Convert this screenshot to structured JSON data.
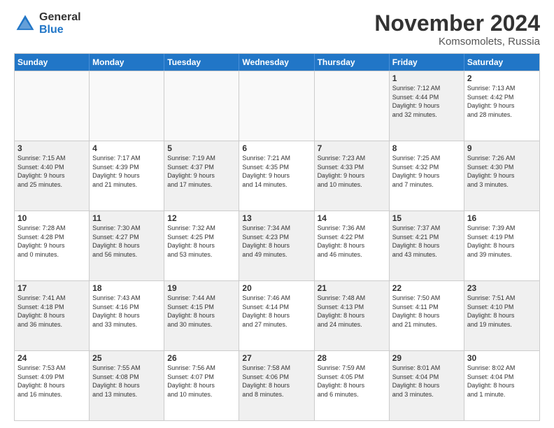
{
  "logo": {
    "general": "General",
    "blue": "Blue"
  },
  "title": "November 2024",
  "subtitle": "Komsomolets, Russia",
  "days": [
    "Sunday",
    "Monday",
    "Tuesday",
    "Wednesday",
    "Thursday",
    "Friday",
    "Saturday"
  ],
  "weeks": [
    [
      {
        "day": "",
        "info": "",
        "shaded": false,
        "empty": true
      },
      {
        "day": "",
        "info": "",
        "shaded": false,
        "empty": true
      },
      {
        "day": "",
        "info": "",
        "shaded": false,
        "empty": true
      },
      {
        "day": "",
        "info": "",
        "shaded": false,
        "empty": true
      },
      {
        "day": "",
        "info": "",
        "shaded": false,
        "empty": true
      },
      {
        "day": "1",
        "info": "Sunrise: 7:12 AM\nSunset: 4:44 PM\nDaylight: 9 hours\nand 32 minutes.",
        "shaded": true
      },
      {
        "day": "2",
        "info": "Sunrise: 7:13 AM\nSunset: 4:42 PM\nDaylight: 9 hours\nand 28 minutes.",
        "shaded": false
      }
    ],
    [
      {
        "day": "3",
        "info": "Sunrise: 7:15 AM\nSunset: 4:40 PM\nDaylight: 9 hours\nand 25 minutes.",
        "shaded": true
      },
      {
        "day": "4",
        "info": "Sunrise: 7:17 AM\nSunset: 4:39 PM\nDaylight: 9 hours\nand 21 minutes.",
        "shaded": false
      },
      {
        "day": "5",
        "info": "Sunrise: 7:19 AM\nSunset: 4:37 PM\nDaylight: 9 hours\nand 17 minutes.",
        "shaded": true
      },
      {
        "day": "6",
        "info": "Sunrise: 7:21 AM\nSunset: 4:35 PM\nDaylight: 9 hours\nand 14 minutes.",
        "shaded": false
      },
      {
        "day": "7",
        "info": "Sunrise: 7:23 AM\nSunset: 4:33 PM\nDaylight: 9 hours\nand 10 minutes.",
        "shaded": true
      },
      {
        "day": "8",
        "info": "Sunrise: 7:25 AM\nSunset: 4:32 PM\nDaylight: 9 hours\nand 7 minutes.",
        "shaded": false
      },
      {
        "day": "9",
        "info": "Sunrise: 7:26 AM\nSunset: 4:30 PM\nDaylight: 9 hours\nand 3 minutes.",
        "shaded": true
      }
    ],
    [
      {
        "day": "10",
        "info": "Sunrise: 7:28 AM\nSunset: 4:28 PM\nDaylight: 9 hours\nand 0 minutes.",
        "shaded": false
      },
      {
        "day": "11",
        "info": "Sunrise: 7:30 AM\nSunset: 4:27 PM\nDaylight: 8 hours\nand 56 minutes.",
        "shaded": true
      },
      {
        "day": "12",
        "info": "Sunrise: 7:32 AM\nSunset: 4:25 PM\nDaylight: 8 hours\nand 53 minutes.",
        "shaded": false
      },
      {
        "day": "13",
        "info": "Sunrise: 7:34 AM\nSunset: 4:23 PM\nDaylight: 8 hours\nand 49 minutes.",
        "shaded": true
      },
      {
        "day": "14",
        "info": "Sunrise: 7:36 AM\nSunset: 4:22 PM\nDaylight: 8 hours\nand 46 minutes.",
        "shaded": false
      },
      {
        "day": "15",
        "info": "Sunrise: 7:37 AM\nSunset: 4:21 PM\nDaylight: 8 hours\nand 43 minutes.",
        "shaded": true
      },
      {
        "day": "16",
        "info": "Sunrise: 7:39 AM\nSunset: 4:19 PM\nDaylight: 8 hours\nand 39 minutes.",
        "shaded": false
      }
    ],
    [
      {
        "day": "17",
        "info": "Sunrise: 7:41 AM\nSunset: 4:18 PM\nDaylight: 8 hours\nand 36 minutes.",
        "shaded": true
      },
      {
        "day": "18",
        "info": "Sunrise: 7:43 AM\nSunset: 4:16 PM\nDaylight: 8 hours\nand 33 minutes.",
        "shaded": false
      },
      {
        "day": "19",
        "info": "Sunrise: 7:44 AM\nSunset: 4:15 PM\nDaylight: 8 hours\nand 30 minutes.",
        "shaded": true
      },
      {
        "day": "20",
        "info": "Sunrise: 7:46 AM\nSunset: 4:14 PM\nDaylight: 8 hours\nand 27 minutes.",
        "shaded": false
      },
      {
        "day": "21",
        "info": "Sunrise: 7:48 AM\nSunset: 4:13 PM\nDaylight: 8 hours\nand 24 minutes.",
        "shaded": true
      },
      {
        "day": "22",
        "info": "Sunrise: 7:50 AM\nSunset: 4:11 PM\nDaylight: 8 hours\nand 21 minutes.",
        "shaded": false
      },
      {
        "day": "23",
        "info": "Sunrise: 7:51 AM\nSunset: 4:10 PM\nDaylight: 8 hours\nand 19 minutes.",
        "shaded": true
      }
    ],
    [
      {
        "day": "24",
        "info": "Sunrise: 7:53 AM\nSunset: 4:09 PM\nDaylight: 8 hours\nand 16 minutes.",
        "shaded": false
      },
      {
        "day": "25",
        "info": "Sunrise: 7:55 AM\nSunset: 4:08 PM\nDaylight: 8 hours\nand 13 minutes.",
        "shaded": true
      },
      {
        "day": "26",
        "info": "Sunrise: 7:56 AM\nSunset: 4:07 PM\nDaylight: 8 hours\nand 10 minutes.",
        "shaded": false
      },
      {
        "day": "27",
        "info": "Sunrise: 7:58 AM\nSunset: 4:06 PM\nDaylight: 8 hours\nand 8 minutes.",
        "shaded": true
      },
      {
        "day": "28",
        "info": "Sunrise: 7:59 AM\nSunset: 4:05 PM\nDaylight: 8 hours\nand 6 minutes.",
        "shaded": false
      },
      {
        "day": "29",
        "info": "Sunrise: 8:01 AM\nSunset: 4:04 PM\nDaylight: 8 hours\nand 3 minutes.",
        "shaded": true
      },
      {
        "day": "30",
        "info": "Sunrise: 8:02 AM\nSunset: 4:04 PM\nDaylight: 8 hours\nand 1 minute.",
        "shaded": false
      }
    ]
  ]
}
